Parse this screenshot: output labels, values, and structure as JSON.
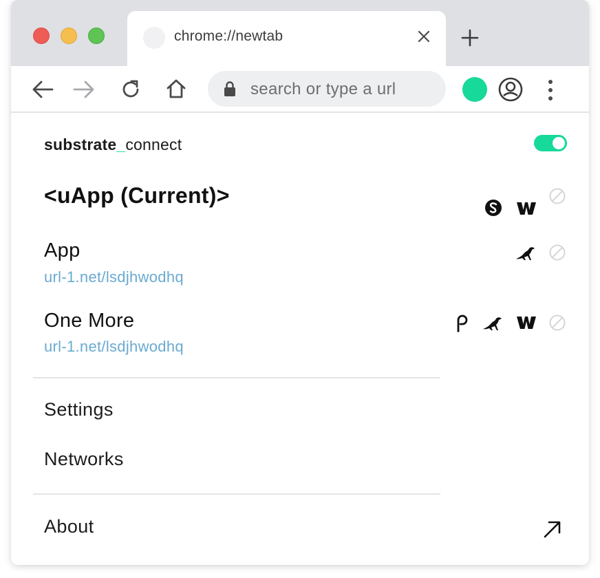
{
  "browser": {
    "tab_title": "chrome://newtab",
    "url_placeholder": "search or type a url"
  },
  "extension": {
    "brand_bold": "substrate",
    "brand_underscore": "_",
    "brand_light": "connect",
    "enabled": true,
    "accent_color": "#16d99a",
    "link_color": "#6aaad0"
  },
  "apps": [
    {
      "name": "<uApp (Current)>",
      "url": "",
      "networks": [
        "substrate-icon",
        "westend-icon"
      ],
      "current": true
    },
    {
      "name": "App",
      "url": "url-1.net/lsdjhwodhq",
      "networks": [
        "kusama-bird-icon"
      ],
      "current": false
    },
    {
      "name": "One More",
      "url": "url-1.net/lsdjhwodhq",
      "networks": [
        "polkadot-icon",
        "kusama-bird-icon",
        "westend-icon"
      ],
      "current": false
    }
  ],
  "menu": {
    "settings": "Settings",
    "networks": "Networks",
    "about": "About"
  }
}
